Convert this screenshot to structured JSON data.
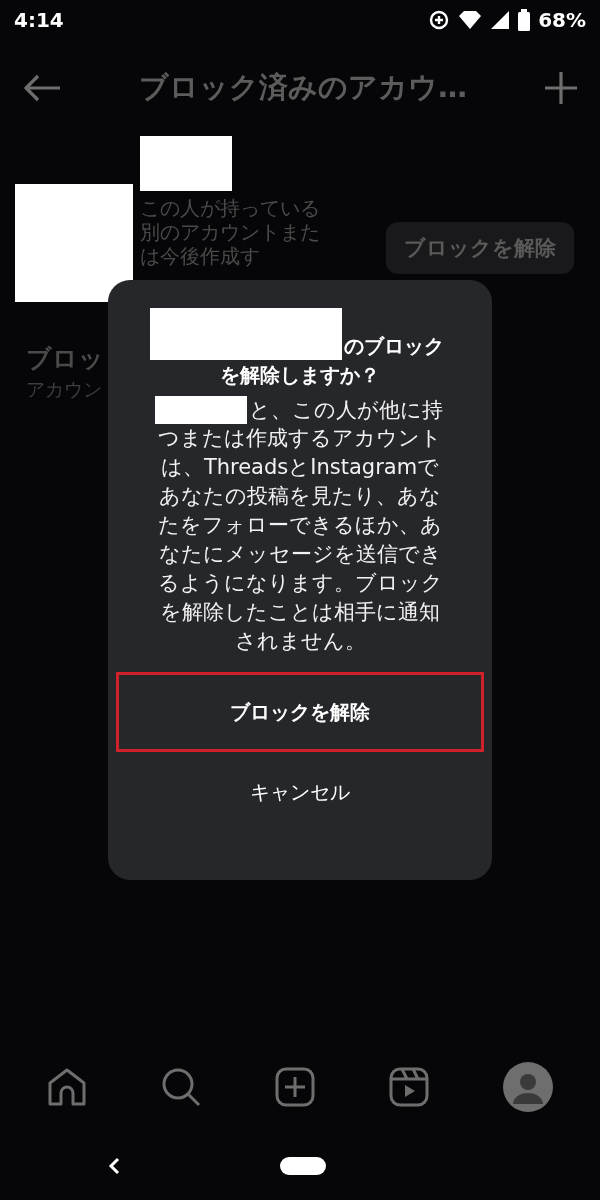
{
  "status_bar": {
    "time": "4:14",
    "battery": "68%"
  },
  "header": {
    "title": "ブロック済みのアカウ…"
  },
  "blocked_accounts": [
    {
      "description": "この人が持っている別のアカウントまたは今後作成す",
      "button": "ブロックを解除"
    }
  ],
  "section": {
    "title": "ブロッ",
    "subtitle": "アカウン"
  },
  "dialog": {
    "title": {
      "first_line": "のブロック",
      "rest": "を解除しますか？"
    },
    "body": {
      "first_line": "と、この人が他に持",
      "rest": "つまたは作成するアカウントは、ThreadsとInstagramであなたの投稿を見たり、あなたをフォローできるほか、あなたにメッセージを送信できるようになります。ブロックを解除したことは相手に通知されません。"
    },
    "buttons": [
      {
        "label": "ブロックを解除",
        "highlighted": true
      },
      {
        "label": "キャンセル",
        "highlighted": false
      }
    ]
  }
}
